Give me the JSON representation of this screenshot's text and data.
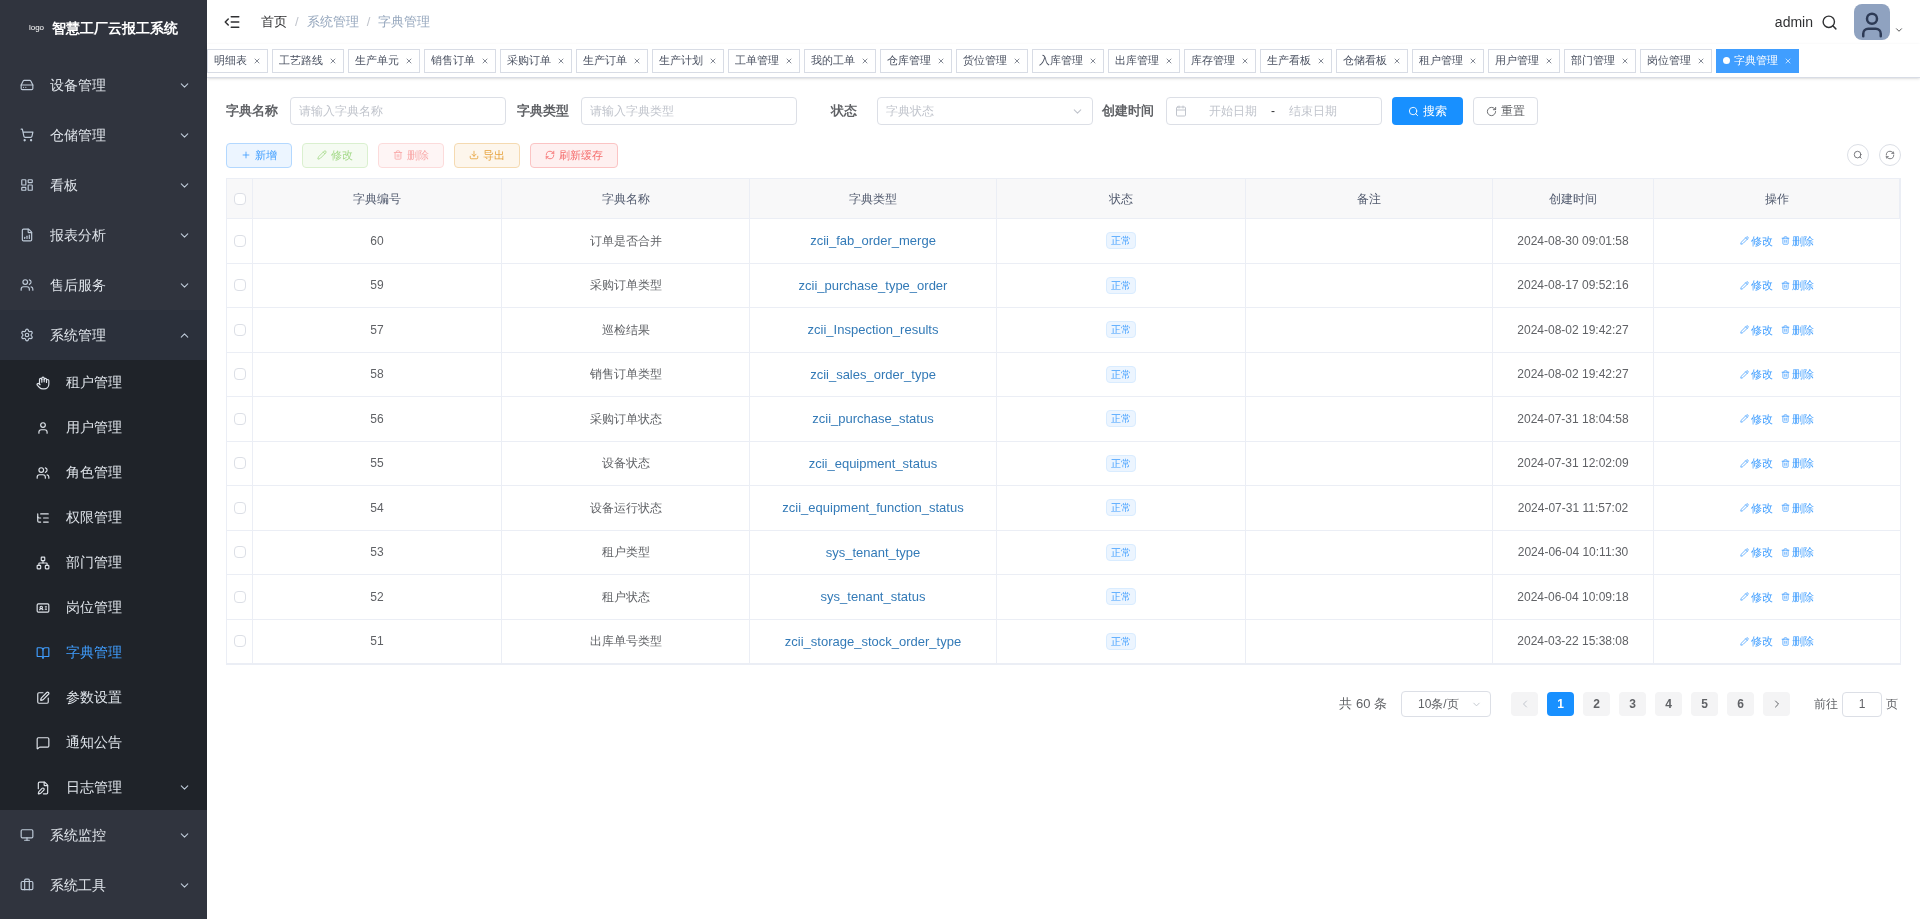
{
  "sidebar": {
    "logo": "logo",
    "title": "智慧工厂云报工系统",
    "items": [
      {
        "label": "设备管理",
        "expanded": false
      },
      {
        "label": "仓储管理",
        "expanded": false
      },
      {
        "label": "看板",
        "expanded": false
      },
      {
        "label": "报表分析",
        "expanded": false
      },
      {
        "label": "售后服务",
        "expanded": false
      },
      {
        "label": "系统管理",
        "expanded": true,
        "children": [
          {
            "label": "租户管理",
            "selected": false
          },
          {
            "label": "用户管理",
            "selected": false
          },
          {
            "label": "角色管理",
            "selected": false
          },
          {
            "label": "权限管理",
            "selected": false
          },
          {
            "label": "部门管理",
            "selected": false
          },
          {
            "label": "岗位管理",
            "selected": false
          },
          {
            "label": "字典管理",
            "selected": true
          },
          {
            "label": "参数设置",
            "selected": false
          },
          {
            "label": "通知公告",
            "selected": false
          },
          {
            "label": "日志管理",
            "selected": false,
            "expanded": false
          }
        ]
      },
      {
        "label": "系统监控",
        "expanded": false
      },
      {
        "label": "系统工具",
        "expanded": false
      }
    ]
  },
  "breadcrumb": [
    {
      "label": "首页"
    },
    {
      "separator": "/",
      "label": "系统管理"
    },
    {
      "separator": "/",
      "label": "字典管理"
    }
  ],
  "user": {
    "name": "admin"
  },
  "tabs": [
    {
      "label": "明细表",
      "selected": false
    },
    {
      "label": "工艺路线",
      "selected": false
    },
    {
      "label": "生产单元",
      "selected": false
    },
    {
      "label": "销售订单",
      "selected": false
    },
    {
      "label": "采购订单",
      "selected": false
    },
    {
      "label": "生产订单",
      "selected": false
    },
    {
      "label": "生产计划",
      "selected": false
    },
    {
      "label": "工单管理",
      "selected": false
    },
    {
      "label": "我的工单",
      "selected": false
    },
    {
      "label": "仓库管理",
      "selected": false
    },
    {
      "label": "货位管理",
      "selected": false
    },
    {
      "label": "入库管理",
      "selected": false
    },
    {
      "label": "出库管理",
      "selected": false
    },
    {
      "label": "库存管理",
      "selected": false
    },
    {
      "label": "生产看板",
      "selected": false
    },
    {
      "label": "仓储看板",
      "selected": false
    },
    {
      "label": "租户管理",
      "selected": false
    },
    {
      "label": "用户管理",
      "selected": false
    },
    {
      "label": "部门管理",
      "selected": false
    },
    {
      "label": "岗位管理",
      "selected": false
    },
    {
      "label": "字典管理",
      "selected": true
    }
  ],
  "filters": {
    "name": {
      "label": "字典名称",
      "placeholder": "请输入字典名称"
    },
    "type": {
      "label": "字典类型",
      "placeholder": "请输入字典类型"
    },
    "status": {
      "label": "状态",
      "placeholder": "字典状态"
    },
    "created": {
      "label": "创建时间",
      "start_placeholder": "开始日期",
      "separator": "-",
      "end_placeholder": "结束日期"
    },
    "search_button": "搜索",
    "reset_button": "重置"
  },
  "toolbar": [
    {
      "label": "新增",
      "kind": "add",
      "disabled": false
    },
    {
      "label": "修改",
      "kind": "edit",
      "disabled": true
    },
    {
      "label": "删除",
      "kind": "delete",
      "disabled": true
    },
    {
      "label": "导出",
      "kind": "export",
      "disabled": false
    },
    {
      "label": "刷新缓存",
      "kind": "refresh",
      "disabled": false
    }
  ],
  "table": {
    "all_checked": false,
    "columns": [
      "字典编号",
      "字典名称",
      "字典类型",
      "状态",
      "备注",
      "创建时间",
      "操作"
    ],
    "rows": [
      {
        "id": "60",
        "name": "订单是否合并",
        "type": "zcii_fab_order_merge",
        "status": "正常",
        "remark": "",
        "created": "2024-08-30 09:01:58",
        "checked": false,
        "actions": [
          "修改",
          "删除"
        ]
      },
      {
        "id": "59",
        "name": "采购订单类型",
        "type": "zcii_purchase_type_order",
        "status": "正常",
        "remark": "",
        "created": "2024-08-17 09:52:16",
        "checked": false,
        "actions": [
          "修改",
          "删除"
        ]
      },
      {
        "id": "57",
        "name": "巡检结果",
        "type": "zcii_Inspection_results",
        "status": "正常",
        "remark": "",
        "created": "2024-08-02 19:42:27",
        "checked": false,
        "actions": [
          "修改",
          "删除"
        ]
      },
      {
        "id": "58",
        "name": "销售订单类型",
        "type": "zcii_sales_order_type",
        "status": "正常",
        "remark": "",
        "created": "2024-08-02 19:42:27",
        "checked": false,
        "actions": [
          "修改",
          "删除"
        ]
      },
      {
        "id": "56",
        "name": "采购订单状态",
        "type": "zcii_purchase_status",
        "status": "正常",
        "remark": "",
        "created": "2024-07-31 18:04:58",
        "checked": false,
        "actions": [
          "修改",
          "删除"
        ]
      },
      {
        "id": "55",
        "name": "设备状态",
        "type": "zcii_equipment_status",
        "status": "正常",
        "remark": "",
        "created": "2024-07-31 12:02:09",
        "checked": false,
        "actions": [
          "修改",
          "删除"
        ]
      },
      {
        "id": "54",
        "name": "设备运行状态",
        "type": "zcii_equipment_function_status",
        "status": "正常",
        "remark": "",
        "created": "2024-07-31 11:57:02",
        "checked": false,
        "actions": [
          "修改",
          "删除"
        ]
      },
      {
        "id": "53",
        "name": "租户类型",
        "type": "sys_tenant_type",
        "status": "正常",
        "remark": "",
        "created": "2024-06-04 10:11:30",
        "checked": false,
        "actions": [
          "修改",
          "删除"
        ]
      },
      {
        "id": "52",
        "name": "租户状态",
        "type": "sys_tenant_status",
        "status": "正常",
        "remark": "",
        "created": "2024-06-04 10:09:18",
        "checked": false,
        "actions": [
          "修改",
          "删除"
        ]
      },
      {
        "id": "51",
        "name": "出库单号类型",
        "type": "zcii_storage_stock_order_type",
        "status": "正常",
        "remark": "",
        "created": "2024-03-22 15:38:08",
        "checked": false,
        "actions": [
          "修改",
          "删除"
        ]
      }
    ]
  },
  "pagination": {
    "total": "共 60 条",
    "page_size": "10条/页",
    "pages": [
      {
        "label": "1",
        "selected": true
      },
      {
        "label": "2",
        "selected": false
      },
      {
        "label": "3",
        "selected": false
      },
      {
        "label": "4",
        "selected": false
      },
      {
        "label": "5",
        "selected": false
      },
      {
        "label": "6",
        "selected": false
      }
    ],
    "goto_label": "前往",
    "goto_value": "1",
    "goto_suffix": "页"
  }
}
